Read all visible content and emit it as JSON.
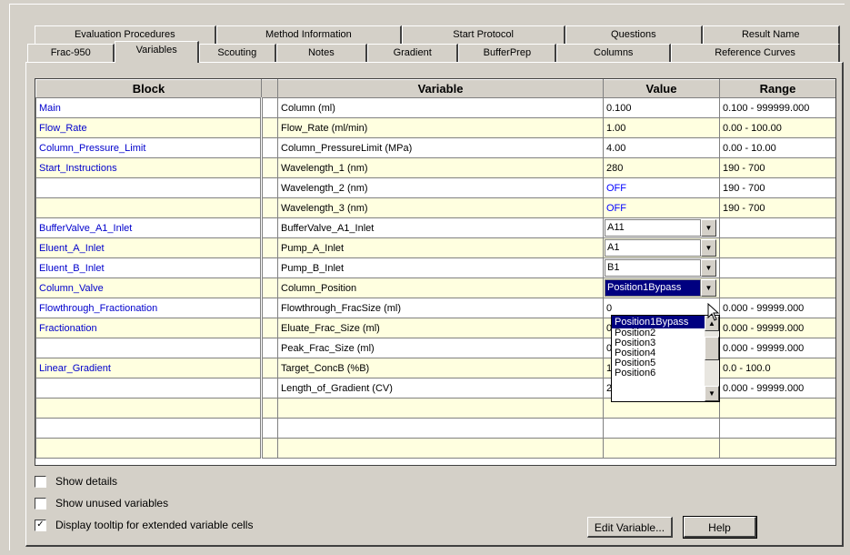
{
  "tabs": {
    "row1": [
      "Evaluation Procedures",
      "Method Information",
      "Start Protocol",
      "Questions",
      "Result Name"
    ],
    "row2": [
      "Frac-950",
      "Variables",
      "Scouting",
      "Notes",
      "Gradient",
      "BufferPrep",
      "Columns",
      "Reference Curves"
    ],
    "selected": "Variables"
  },
  "grid": {
    "headers": {
      "block": "Block",
      "variable": "Variable",
      "value": "Value",
      "range": "Range"
    },
    "rows": [
      {
        "block": "Main",
        "variable": "Column (ml)",
        "value": "0.100",
        "range": "0.100 - 999999.000"
      },
      {
        "block": "Flow_Rate",
        "variable": "Flow_Rate (ml/min)",
        "value": "1.00",
        "range": "0.00 - 100.00"
      },
      {
        "block": "Column_Pressure_Limit",
        "variable": "Column_PressureLimit (MPa)",
        "value": "4.00",
        "range": "0.00 - 10.00"
      },
      {
        "block": "Start_Instructions",
        "variable": "Wavelength_1 (nm)",
        "value": "280",
        "range": "190 - 700"
      },
      {
        "block": "",
        "variable": "Wavelength_2 (nm)",
        "value": "OFF",
        "range": "190 - 700"
      },
      {
        "block": "",
        "variable": "Wavelength_3 (nm)",
        "value": "OFF",
        "range": "190 - 700"
      },
      {
        "block": "BufferValve_A1_Inlet",
        "variable": "BufferValve_A1_Inlet",
        "value": "A11",
        "range": ""
      },
      {
        "block": "Eluent_A_Inlet",
        "variable": "Pump_A_Inlet",
        "value": "A1",
        "range": ""
      },
      {
        "block": "Eluent_B_Inlet",
        "variable": "Pump_B_Inlet",
        "value": "B1",
        "range": ""
      },
      {
        "block": "Column_Valve",
        "variable": "Column_Position",
        "value": "Position1Bypass",
        "range": ""
      },
      {
        "block": "Flowthrough_Fractionation",
        "variable": "Flowthrough_FracSize (ml)",
        "value": "0",
        "range": "0.000 - 99999.000"
      },
      {
        "block": "Fractionation",
        "variable": "Eluate_Frac_Size (ml)",
        "value": "0",
        "range": "0.000 - 99999.000"
      },
      {
        "block": "",
        "variable": "Peak_Frac_Size (ml)",
        "value": "0",
        "range": "0.000 - 99999.000"
      },
      {
        "block": "Linear_Gradient",
        "variable": "Target_ConcB (%B)",
        "value": "1",
        "range": "0.0 - 100.0"
      },
      {
        "block": "",
        "variable": "Length_of_Gradient (CV)",
        "value": "20.000",
        "range": "0.000 - 99999.000"
      },
      {
        "block": "",
        "variable": "",
        "value": "",
        "range": ""
      },
      {
        "block": "",
        "variable": "",
        "value": "",
        "range": ""
      },
      {
        "block": "",
        "variable": "",
        "value": "",
        "range": ""
      }
    ]
  },
  "dropdown": {
    "options": [
      "Position1Bypass",
      "Position2",
      "Position3",
      "Position4",
      "Position5",
      "Position6"
    ],
    "selected": "Position1Bypass"
  },
  "options": {
    "show_details": {
      "label": "Show details",
      "checked": false
    },
    "show_unused": {
      "label": "Show unused variables",
      "checked": false
    },
    "display_tooltip": {
      "label": "Display tooltip for extended variable cells",
      "checked": true
    }
  },
  "buttons": {
    "edit_variable": "Edit Variable...",
    "help": "Help"
  },
  "colors": {
    "row_yellow": "#ffffe0",
    "block_text": "#0000cc",
    "off_value": "#0000ff",
    "highlight": "#000080"
  },
  "icons": {
    "combo_arrow": "chevron-down-icon",
    "pointer": "arrow-cursor-icon",
    "check": "check-icon"
  }
}
